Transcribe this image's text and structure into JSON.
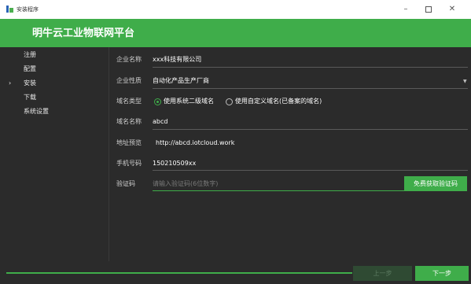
{
  "window": {
    "title": "安装程序",
    "minimize_glyph": "–",
    "close_glyph": "✕"
  },
  "header": {
    "brand": "明牛云工业物联网平台"
  },
  "sidebar": {
    "items": [
      {
        "label": "注册"
      },
      {
        "label": "配置"
      },
      {
        "label": "安装",
        "active": true
      },
      {
        "label": "下载"
      },
      {
        "label": "系统设置"
      }
    ],
    "active_marker": "›"
  },
  "form": {
    "company_name": {
      "label": "企业名称",
      "value": "xxx科技有限公司"
    },
    "company_type": {
      "label": "企业性质",
      "value": "自动化产品生产厂商"
    },
    "domain_type": {
      "label": "域名类型",
      "options": [
        {
          "label": "使用系统二级域名",
          "selected": true
        },
        {
          "label": "使用自定义域名(已备案的域名)",
          "selected": false
        }
      ]
    },
    "domain_name": {
      "label": "域名名称",
      "value": "abcd"
    },
    "address_preview": {
      "label": "地址预览",
      "value": "http://abcd.iotcloud.work"
    },
    "phone": {
      "label": "手机号码",
      "value": "150210509xx"
    },
    "verify_code": {
      "label": "验证码",
      "placeholder": "请输入验证码(6位数字)",
      "button": "免费获取验证码"
    }
  },
  "footer": {
    "prev": "上一步",
    "next": "下一步"
  },
  "colors": {
    "accent": "#3fad4a",
    "background": "#2b2b2b"
  },
  "icons": {
    "app": "app-logo-icon",
    "select": "chevron-down-icon"
  }
}
